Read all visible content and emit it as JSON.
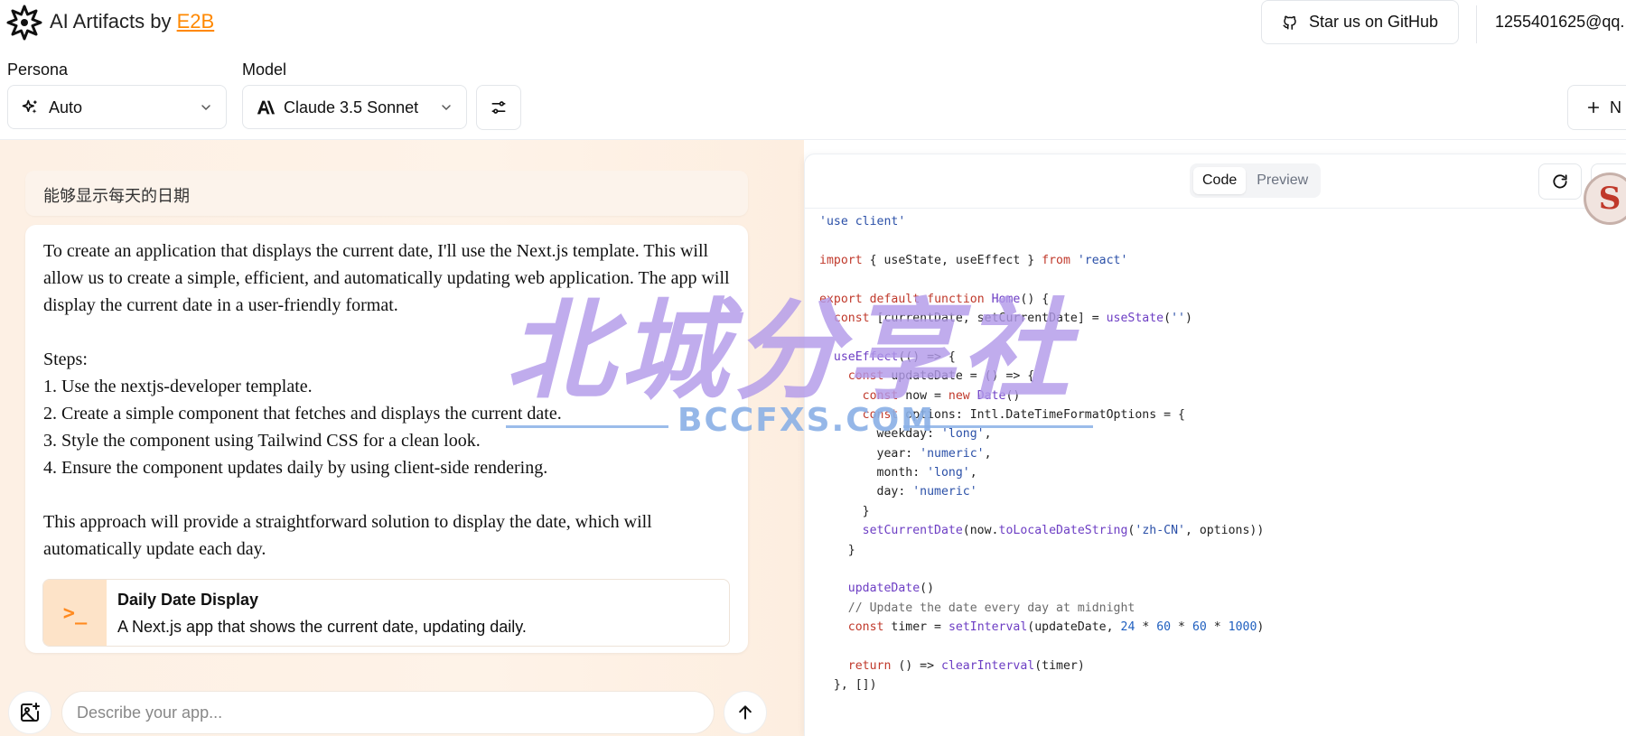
{
  "header": {
    "app_title_prefix": "AI Artifacts by",
    "app_title_link": "E2B",
    "github_label": "Star us on GitHub",
    "user_email": "1255401625@qq."
  },
  "controls": {
    "persona_label": "Persona",
    "persona_value": "Auto",
    "model_label": "Model",
    "model_value": "Claude 3.5 Sonnet",
    "new_label": "N"
  },
  "chat": {
    "user_message": "能够显示每天的日期",
    "assistant_paragraphs": [
      "To create an application that displays the current date, I'll use the Next.js template. This will allow us to create a simple, efficient, and automatically updating web application. The app will display the current date in a user-friendly format.",
      "Steps:",
      "1. Use the nextjs-developer template.",
      "2. Create a simple component that fetches and displays the current date.",
      "3. Style the component using Tailwind CSS for a clean look.",
      "4. Ensure the component updates daily by using client-side rendering.",
      "This approach will provide a straightforward solution to display the date, which will automatically update each day."
    ],
    "artifact": {
      "icon_text": ">_",
      "title": "Daily Date Display",
      "description": "A Next.js app that shows the current date, updating daily."
    },
    "input_placeholder": "Describe your app..."
  },
  "code_panel": {
    "tabs": [
      "Code",
      "Preview"
    ],
    "active_tab": "Code",
    "badge_letter": "S",
    "lines": [
      "'use client'",
      "",
      "import { useState, useEffect } from 'react'",
      "",
      "export default function Home() {",
      "  const [currentDate, setCurrentDate] = useState('')",
      "",
      "  useEffect(() => {",
      "    const updateDate = () => {",
      "      const now = new Date()",
      "      const options: Intl.DateTimeFormatOptions = {",
      "        weekday: 'long',",
      "        year: 'numeric',",
      "        month: 'long',",
      "        day: 'numeric'",
      "      }",
      "      setCurrentDate(now.toLocaleDateString('zh-CN', options))",
      "    }",
      "",
      "    updateDate()",
      "    // Update the date every day at midnight",
      "    const timer = setInterval(updateDate, 24 * 60 * 60 * 1000)",
      "",
      "    return () => clearInterval(timer)",
      "  }, [])"
    ]
  },
  "watermark": {
    "main_text": "北城分享社",
    "sub_text": "BCCFXS.COM"
  },
  "colors": {
    "accent_orange": "#ff8800",
    "chat_background": "#fef3e8",
    "watermark_purple": "#b39bea",
    "watermark_blue": "#8ab0e6"
  }
}
